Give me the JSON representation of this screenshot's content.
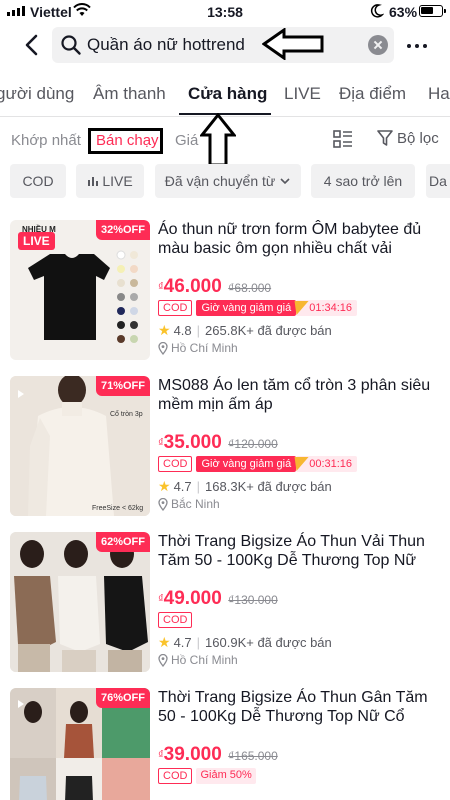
{
  "status_bar": {
    "carrier": "Viettel",
    "time": "13:58",
    "battery": "63%"
  },
  "search": {
    "query": "Quần áo nữ hottrend"
  },
  "tabs": [
    {
      "label": "gười dùng"
    },
    {
      "label": "Âm thanh"
    },
    {
      "label": "Cửa hàng",
      "active": true
    },
    {
      "label": "LIVE"
    },
    {
      "label": "Địa điểm"
    },
    {
      "label": "Ha"
    }
  ],
  "sort": {
    "options": [
      {
        "label": "Khớp nhất"
      },
      {
        "label": "Bán chạy",
        "active": true
      },
      {
        "label": "Giá"
      }
    ],
    "filter_label": "Bộ lọc"
  },
  "chips": [
    {
      "label": "COD"
    },
    {
      "label": "LIVE"
    },
    {
      "label": "Đã vận chuyển từ"
    },
    {
      "label": "4 sao trở lên"
    },
    {
      "label": "Da"
    }
  ],
  "products": [
    {
      "title": "Áo thun nữ trơn form ÔM babytee đủ màu basic ôm gọn nhiều chất vải",
      "discount": "32%OFF",
      "live": "LIVE",
      "currency": "₫",
      "price": "46.000",
      "old_price": "₫68.000",
      "cod": "COD",
      "flash_label": "Giờ vàng giảm giá",
      "flash_time": "01:34:16",
      "rating": "4.8",
      "sold": "265.8K+ đã được bán",
      "location": "Hồ Chí Minh",
      "thumb_text": "NHIỀU M"
    },
    {
      "title": "MS088 Áo len tăm cổ tròn 3 phân siêu mềm mịn ấm áp",
      "discount": "71%OFF",
      "currency": "₫",
      "price": "35.000",
      "old_price": "₫120.000",
      "cod": "COD",
      "flash_label": "Giờ vàng giảm giá",
      "flash_time": "00:31:16",
      "rating": "4.7",
      "sold": "168.3K+ đã được bán",
      "location": "Bắc Ninh",
      "thumb_text": "FreeSize < 62kg",
      "thumb_text2": "Cổ tròn 3p"
    },
    {
      "title": "Thời Trang Bigsize Áo Thun Vải Thun Tăm  50 - 100Kg Dễ Thương Top Nữ C...",
      "discount": "62%OFF",
      "currency": "₫",
      "price": "49.000",
      "old_price": "₫130.000",
      "cod": "COD",
      "rating": "4.7",
      "sold": "160.9K+ đã được bán",
      "location": "Hồ Chí Minh"
    },
    {
      "title": "Thời Trang Bigsize Áo Thun Gân Tăm 50 - 100Kg Dễ Thương Top Nữ Cổ Tròn",
      "discount": "76%OFF",
      "currency": "₫",
      "price": "39.000",
      "old_price": "₫165.000",
      "cod": "COD",
      "discount_tag": "Giảm 50%"
    }
  ],
  "colors": {
    "accent": "#fe2c55",
    "star": "#fac32b"
  }
}
